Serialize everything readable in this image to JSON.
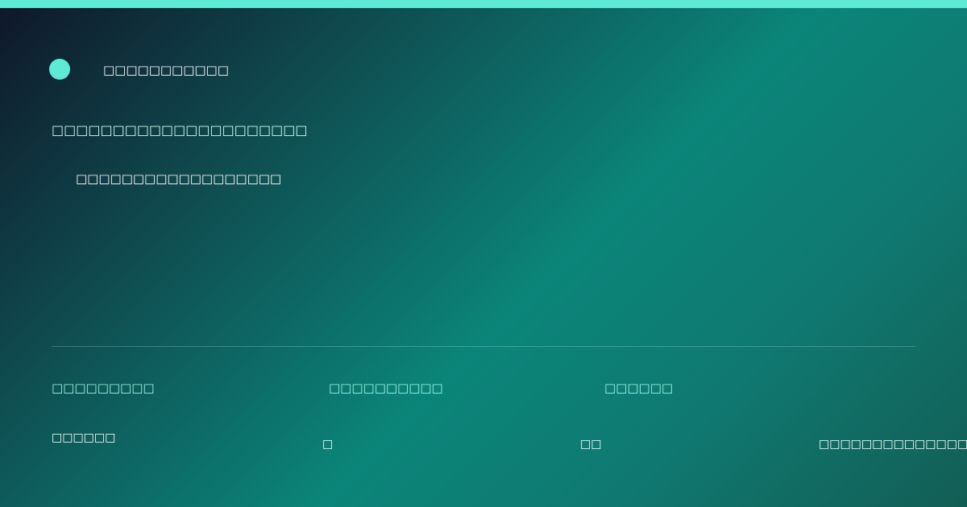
{
  "colors": {
    "accent": "#5eead4",
    "label": "#99f6e4",
    "text": "#ffffff"
  },
  "brand": {
    "name": "□□□□□□□□□□□"
  },
  "hero": {
    "headline": "□□□□□□□□□□□□□□□□□□□□□",
    "subline": "□□□□□□□□□□□□□□□□□□"
  },
  "details": {
    "labels": [
      "□□□□□□□□□",
      "□□□□□□□□□□",
      "□□□□□□"
    ],
    "values": [
      "□□□□□□",
      "□",
      "□□",
      "□□□□□□□□□□□□□□□□"
    ]
  }
}
